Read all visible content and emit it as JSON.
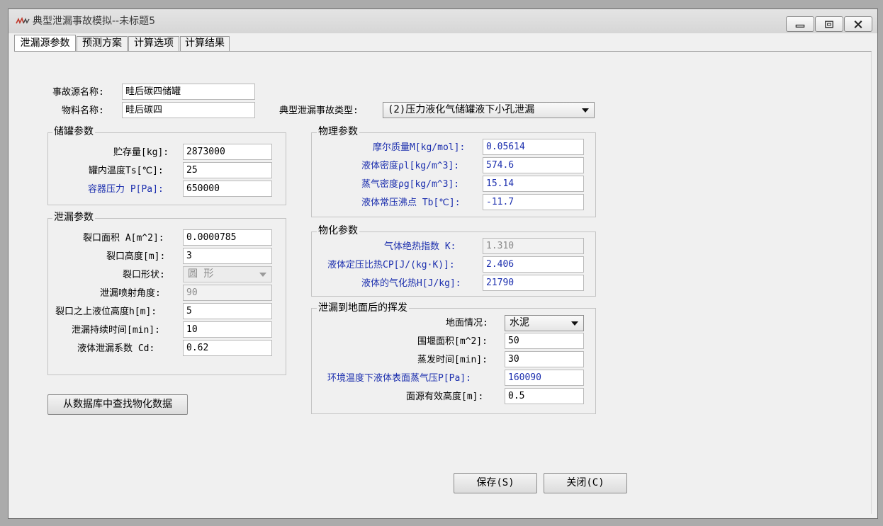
{
  "window": {
    "title": "典型泄漏事故模拟--未标题5"
  },
  "tabs": [
    {
      "label": "泄漏源参数",
      "active": true
    },
    {
      "label": "预测方案",
      "active": false
    },
    {
      "label": "计算选项",
      "active": false
    },
    {
      "label": "计算结果",
      "active": false
    }
  ],
  "source": {
    "name_label": "事故源名称:",
    "name_value": "畦后碳四储罐",
    "material_label": "物料名称:",
    "material_value": "畦后碳四",
    "accident_type_label": "典型泄漏事故类型:",
    "accident_type_value": "(2)压力液化气储罐液下小孔泄漏"
  },
  "tank": {
    "title": "储罐参数",
    "fields": [
      {
        "label": "贮存量[kg]:",
        "value": "2873000",
        "blue": false
      },
      {
        "label": "罐内温度Ts[℃]:",
        "value": "25",
        "blue": false
      },
      {
        "label": "容器压力 P[Pa]:",
        "value": "650000",
        "blue": true
      }
    ]
  },
  "leak": {
    "title": "泄漏参数",
    "area_label": "裂口面积 A[m^2]:",
    "area_value": "0.0000785",
    "height_label": "裂口高度[m]:",
    "height_value": "3",
    "shape_label": "裂口形状:",
    "shape_value": "圆  形",
    "angle_label": "泄漏喷射角度:",
    "angle_value": "90",
    "level_label": "裂口之上液位高度h[m]:",
    "level_value": "5",
    "duration_label": "泄漏持续时间[min]:",
    "duration_value": "10",
    "coef_label": "液体泄漏系数  Cd:",
    "coef_value": "0.62"
  },
  "physical": {
    "title": "物理参数",
    "fields": [
      {
        "label": "摩尔质量M[kg/mol]:",
        "value": "0.05614"
      },
      {
        "label": "液体密度ρl[kg/m^3]:",
        "value": "574.6"
      },
      {
        "label": "蒸气密度ρg[kg/m^3]:",
        "value": "15.14"
      },
      {
        "label": "液体常压沸点 Tb[℃]:",
        "value": "-11.7"
      }
    ]
  },
  "physchem": {
    "title": "物化参数",
    "fields": [
      {
        "label": "气体绝热指数 K:",
        "value": "1.310",
        "disabled": true
      },
      {
        "label": "液体定压比热CP[J/(kg·K)]:",
        "value": "2.406",
        "disabled": false
      },
      {
        "label": "液体的气化热H[J/kg]:",
        "value": "21790",
        "disabled": false
      }
    ]
  },
  "evap": {
    "title": "泄漏到地面后的挥发",
    "ground_label": "地面情况:",
    "ground_value": "水泥",
    "dike_label": "围堰面积[m^2]:",
    "dike_value": "50",
    "evap_time_label": "蒸发时间[min]:",
    "evap_time_value": "30",
    "vapor_pressure_label": "环境温度下液体表面蒸气压P[Pa]:",
    "vapor_pressure_value": "160090",
    "source_height_label": "面源有效高度[m]:",
    "source_height_value": "0.5"
  },
  "buttons": {
    "lookup": "从数据库中查找物化数据",
    "save": "保存(S)",
    "close": "关闭(C)"
  },
  "colors": {
    "blue_label": "#1c2fae",
    "window_bg": "#f0f0f0"
  }
}
